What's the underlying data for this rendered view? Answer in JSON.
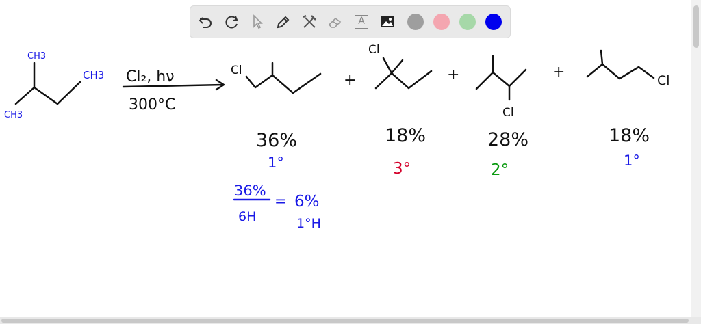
{
  "toolbar": {
    "tools": [
      {
        "name": "undo-icon"
      },
      {
        "name": "redo-icon"
      },
      {
        "name": "select-pointer-icon"
      },
      {
        "name": "pen-icon"
      },
      {
        "name": "tools-icon"
      },
      {
        "name": "eraser-icon"
      },
      {
        "name": "text-icon",
        "glyph": "A"
      },
      {
        "name": "image-icon"
      }
    ],
    "colors": {
      "gray": "#9e9e9e",
      "pink": "#f4a6b0",
      "green": "#a6d8a8",
      "blue": "#0000ee"
    }
  },
  "ink_colors": {
    "black": "#111111",
    "blue": "#1a1ae6",
    "red": "#d4002a",
    "green": "#0a9a10"
  },
  "drawing": {
    "reactant_labels": {
      "ch3_top": "CH3",
      "ch3_right": "CH3",
      "ch3_left": "CH3"
    },
    "reagent": {
      "top": "Cl₂, hν",
      "bottom": "300°C"
    },
    "plus": "+",
    "cl": "Cl",
    "products": [
      {
        "percent": "36%",
        "degree": "1°"
      },
      {
        "percent": "18%",
        "degree": "3°"
      },
      {
        "percent": "28%",
        "degree": "2°"
      },
      {
        "percent": "18%",
        "degree": "1°"
      }
    ],
    "calc": {
      "numerator": "36%",
      "denominator": "6H",
      "equals": "=",
      "result": "6%",
      "result_unit": "1°H"
    }
  }
}
